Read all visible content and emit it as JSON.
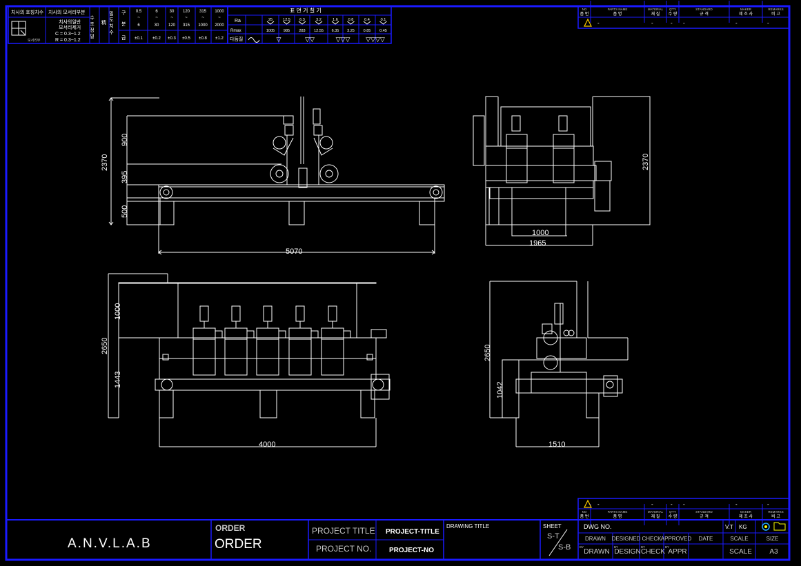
{
  "tolerance_table": {
    "headers": [
      "치사의 호칭치수",
      "치사의 모서리부분"
    ],
    "note": [
      "치사의일반",
      "모서리제거"
    ],
    "cc": "C = 0.3~1.2",
    "rr": "R = 0.3~1.2",
    "tiny_label": "모서리부",
    "class_col": [
      "수 조 정 밀",
      "精",
      "밀 도 치 수"
    ],
    "gu_col": [
      "구",
      "분",
      "급"
    ],
    "ranges_top": [
      "0.5",
      "6",
      "30",
      "120",
      "315",
      "1000"
    ],
    "ranges_bottom": [
      "6",
      "30",
      "120",
      "315",
      "1000",
      "2000"
    ],
    "tolerances": [
      "±0.1",
      "±0.2",
      "±0.3",
      "±0.5",
      "±0.8",
      "±1.2"
    ]
  },
  "roughness_table": {
    "title": "표 면 거 칠 기",
    "row_labels": [
      "Ra",
      "Rmax",
      "다듬질"
    ],
    "ra": [
      "25",
      "12.5",
      "6.3",
      "3.2",
      "1.6",
      "0.8",
      "0.4",
      "0.1"
    ],
    "rmax": [
      "1005",
      "985",
      "283",
      "12.55",
      "6.35",
      "3.25",
      "0.85",
      "0.45"
    ],
    "finish": [
      "▽",
      "▽▽",
      "▽▽▽",
      "▽▽▽▽"
    ]
  },
  "parts_header": {
    "cols": [
      "NO",
      "PARTS NAME",
      "MATERIAL",
      "Q'TY",
      "STANDARD",
      "MAKER",
      "REMARKS"
    ],
    "cols_kr": [
      "품 번",
      "품 명",
      "재 질",
      "수 량",
      "규 격",
      "제 조 사",
      "비 고"
    ],
    "dash": "-"
  },
  "dimensions": {
    "front_height": "2370",
    "front_upper": "900",
    "front_mid": "395",
    "front_lower": "500",
    "front_width": "5070",
    "side_height": "2370",
    "side_inner_w": "1000",
    "side_outer_w": "1965",
    "bottom_front_height": "2650",
    "bottom_front_upper": "1000",
    "bottom_front_lower": "1443",
    "bottom_front_width": "4000",
    "bottom_side_height": "2650",
    "bottom_side_lower": "1042",
    "bottom_side_width": "1510"
  },
  "title_block": {
    "company": "A.N.V.L.A.B",
    "order_small": "ORDER",
    "order_large": "ORDER",
    "project_title_label": "PROJECT TITLE",
    "project_title_value": "PROJECT-TITLE",
    "project_no_label": "PROJECT NO.",
    "project_no_value": "PROJECT-NO",
    "drawing_title_label": "DRAWING TITLE",
    "sheet_label": "SHEET",
    "sheet_top": "S-T",
    "sheet_bottom": "S-B",
    "dwg_no_label": "DWG NO.",
    "vt": "V.T",
    "kg": "KG",
    "row_labels": [
      "DRAWN",
      "DESIGNED",
      "CHECK",
      "APPROVED",
      "DATE",
      "SCALE",
      "SIZE"
    ],
    "row_values": [
      "DRAWN",
      "DESIGN",
      "CHECK",
      "APPR",
      "",
      "SCALE",
      "A3"
    ],
    "by": "BY"
  },
  "colors": {
    "border": "#1a1aff",
    "lines": "#ffffff",
    "warning": "#ffcc00"
  }
}
